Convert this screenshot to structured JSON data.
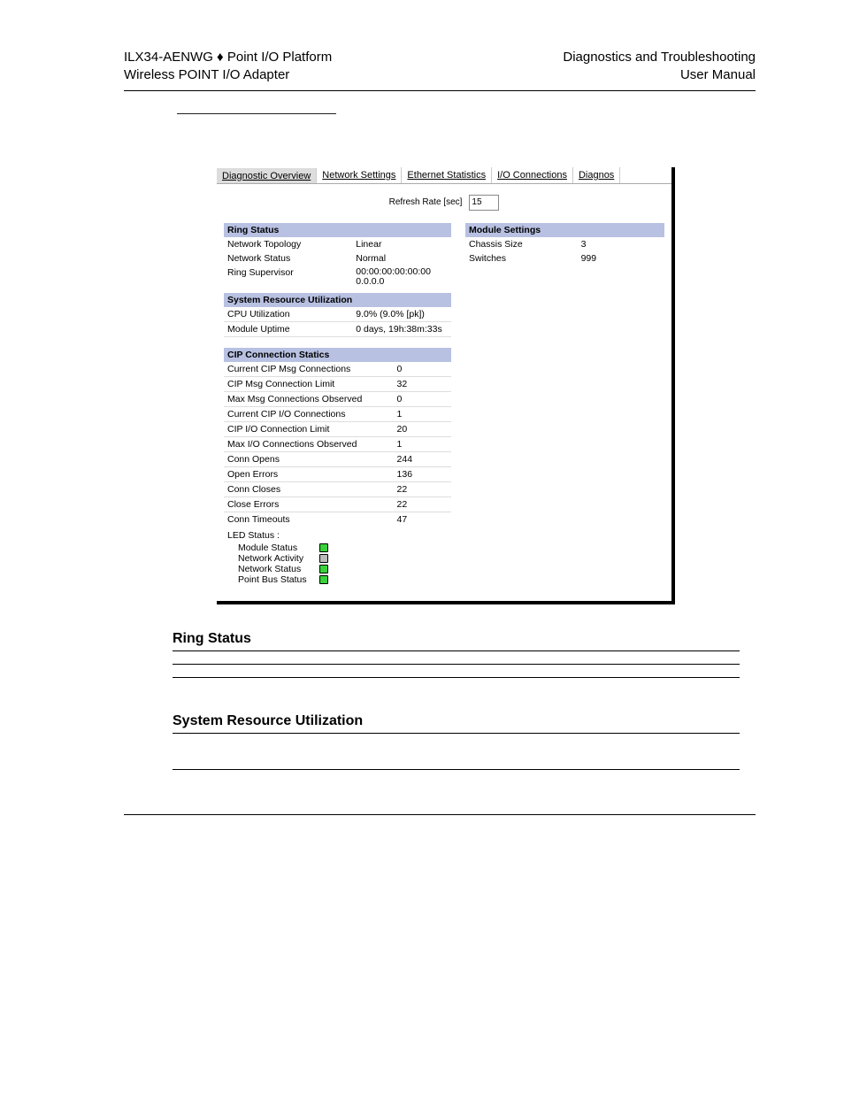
{
  "header": {
    "topLeft1": "ILX34-AENWG ♦ Point I/O Platform",
    "topLeft2": "Wireless POINT I/O Adapter",
    "topRight1": "Diagnostics and Troubleshooting",
    "topRight2": "User Manual"
  },
  "tabs": {
    "t0": "Diagnostic Overview",
    "t1": "Network Settings",
    "t2": "Ethernet Statistics",
    "t3": "I/O Connections",
    "t4": "Diagnos"
  },
  "refresh": {
    "label": "Refresh Rate [sec]",
    "value": "15"
  },
  "ringStatus": {
    "head": "Ring Status",
    "r0k": "Network Topology",
    "r0v": "Linear",
    "r1k": "Network Status",
    "r1v": "Normal",
    "r2k": "Ring Supervisor",
    "r2v": "00:00:00:00:00:00 0.0.0.0"
  },
  "sysres": {
    "head": "System Resource Utilization",
    "r0k": "CPU Utilization",
    "r0v": "9.0% (9.0% [pk])",
    "r1k": "Module Uptime",
    "r1v": "0 days, 19h:38m:33s"
  },
  "cip": {
    "head": "CIP Connection Statics",
    "r0k": "Current CIP Msg Connections",
    "r0v": "0",
    "r1k": "CIP Msg Connection Limit",
    "r1v": "32",
    "r2k": "Max Msg Connections Observed",
    "r2v": "0",
    "r3k": "Current CIP I/O Connections",
    "r3v": "1",
    "r4k": "CIP I/O Connection Limit",
    "r4v": "20",
    "r5k": "Max I/O Connections Observed",
    "r5v": "1",
    "r6k": "Conn Opens",
    "r6v": "244",
    "r7k": "Open Errors",
    "r7v": "136",
    "r8k": "Conn Closes",
    "r8v": "22",
    "r9k": "Close Errors",
    "r9v": "22",
    "r10k": "Conn Timeouts",
    "r10v": "47"
  },
  "led": {
    "title": "LED Status :",
    "i0": "Module Status",
    "i1": "Network Activity",
    "i2": "Network Status",
    "i3": "Point Bus Status"
  },
  "modset": {
    "head": "Module Settings",
    "r0k": "Chassis Size",
    "r0v": "3",
    "r1k": "Switches",
    "r1v": "999"
  },
  "sections": {
    "s1": "Ring Status",
    "s2": "System Resource Utilization"
  }
}
